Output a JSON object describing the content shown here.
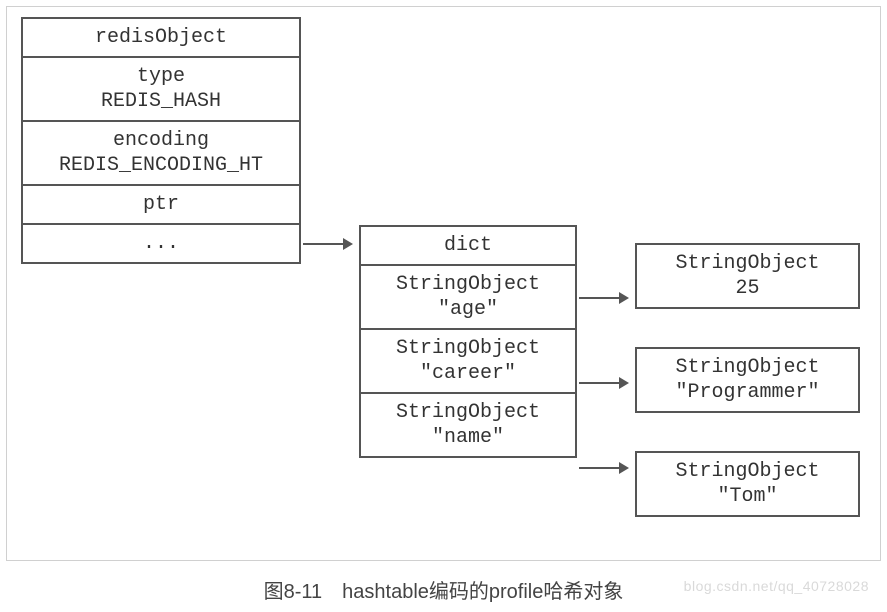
{
  "redisObject": {
    "title": "redisObject",
    "type_label": "type",
    "type_value": "REDIS_HASH",
    "encoding_label": "encoding",
    "encoding_value": "REDIS_ENCODING_HT",
    "ptr_label": "ptr",
    "more": "..."
  },
  "dict": {
    "title": "dict",
    "entries": [
      {
        "key_type": "StringObject",
        "key_value": "\"age\""
      },
      {
        "key_type": "StringObject",
        "key_value": "\"career\""
      },
      {
        "key_type": "StringObject",
        "key_value": "\"name\""
      }
    ]
  },
  "values": [
    {
      "type": "StringObject",
      "value": "25"
    },
    {
      "type": "StringObject",
      "value": "\"Programmer\""
    },
    {
      "type": "StringObject",
      "value": "\"Tom\""
    }
  ],
  "caption": "图8-11　hashtable编码的profile哈希对象",
  "watermark": "blog.csdn.net/qq_40728028"
}
